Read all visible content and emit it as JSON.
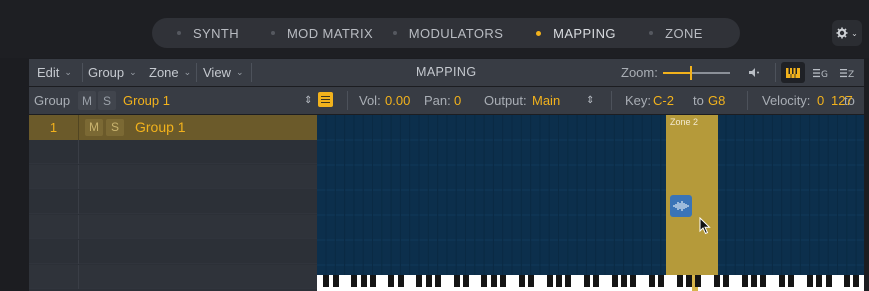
{
  "tabs": [
    {
      "label": "SYNTH",
      "active": false
    },
    {
      "label": "MOD MATRIX",
      "active": false
    },
    {
      "label": "MODULATORS",
      "active": false
    },
    {
      "label": "MAPPING",
      "active": true
    },
    {
      "label": "ZONE",
      "active": false
    }
  ],
  "header": {
    "menus": [
      "Edit",
      "Group",
      "Zone",
      "View"
    ],
    "title": "MAPPING",
    "zoom_label": "Zoom:"
  },
  "group_bar": {
    "group_label": "Group",
    "mute": "M",
    "solo": "S",
    "group_name": "Group 1",
    "vol_label": "Vol:",
    "vol_value": "0.00",
    "pan_label": "Pan:",
    "pan_value": "0",
    "output_label": "Output:",
    "output_value": "Main",
    "key_label": "Key:",
    "key_low": "C-2",
    "key_to_label": "to",
    "key_high": "G8",
    "velocity_label": "Velocity:",
    "velocity_low": "0",
    "velocity_to_label": "to",
    "velocity_high": "127"
  },
  "groups": [
    {
      "number": "1",
      "mute": "M",
      "solo": "S",
      "name": "Group 1"
    }
  ],
  "zones": [
    {
      "label": "Zone 2"
    }
  ],
  "colors": {
    "accent": "#f2b21c",
    "grid_bg": "#0c2f4c",
    "zone_fill": "#b59a3a",
    "group_row": "#6b5a2a"
  }
}
